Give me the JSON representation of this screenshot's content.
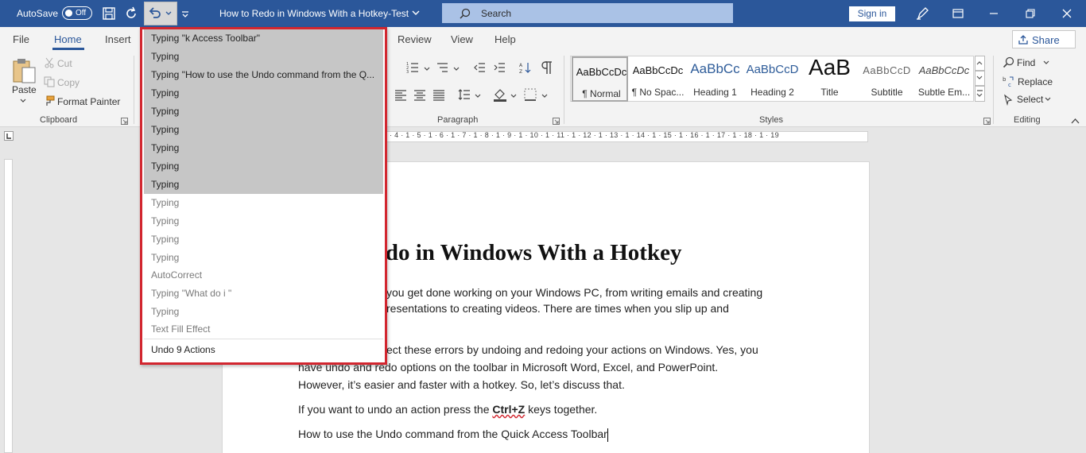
{
  "titlebar": {
    "autosave_label": "AutoSave",
    "autosave_state": "Off",
    "document_title": "How to Redo in Windows With a Hotkey-Test",
    "search_placeholder": "Search",
    "sign_in_label": "Sign in",
    "bar_color": "#2b579a"
  },
  "tabs": {
    "items": [
      "File",
      "Home",
      "Insert",
      "Review",
      "View",
      "Help"
    ],
    "active": "Home",
    "share_label": "Share"
  },
  "ribbon": {
    "clipboard": {
      "paste": "Paste",
      "cut": "Cut",
      "copy": "Copy",
      "format_painter": "Format Painter",
      "group_label": "Clipboard"
    },
    "paragraph": {
      "group_label": "Paragraph"
    },
    "styles": {
      "group_label": "Styles",
      "items": [
        {
          "preview": "AaBbCcDc",
          "name": "¶ Normal"
        },
        {
          "preview": "AaBbCcDc",
          "name": "¶ No Spac..."
        },
        {
          "preview": "AaBbCc",
          "name": "Heading 1"
        },
        {
          "preview": "AaBbCcD",
          "name": "Heading 2"
        },
        {
          "preview": "AaB",
          "name": "Title"
        },
        {
          "preview": "AaBbCcD",
          "name": "Subtitle"
        },
        {
          "preview": "AaBbCcDc",
          "name": "Subtle Em..."
        }
      ]
    },
    "editing": {
      "find": "Find",
      "replace": "Replace",
      "select": "Select",
      "group_label": "Editing"
    }
  },
  "ruler": {
    "numbers": "· 4 · 1 · 5 · 1 · 6 · 1 · 7 · 1 · 8 · 1 · 9 · 1 · 10 · 1 · 11 · 1 · 12 · 1 · 13 · 1 · 14 · 1 · 15 · 1 · 16 · 1 · 17 · 1 · 18 · 1 · 19"
  },
  "undo_dropdown": {
    "items": [
      {
        "label": "Typing \"k Access Toolbar\"",
        "selected": true
      },
      {
        "label": "Typing",
        "selected": true
      },
      {
        "label": "Typing \"How to use the Undo command from the Q...",
        "selected": true
      },
      {
        "label": "Typing",
        "selected": true
      },
      {
        "label": "Typing",
        "selected": true
      },
      {
        "label": "Typing",
        "selected": true
      },
      {
        "label": "Typing",
        "selected": true
      },
      {
        "label": "Typing",
        "selected": true
      },
      {
        "label": "Typing",
        "selected": true
      },
      {
        "label": "Typing",
        "selected": false
      },
      {
        "label": "Typing",
        "selected": false
      },
      {
        "label": "Typing",
        "selected": false
      },
      {
        "label": "Typing",
        "selected": false
      },
      {
        "label": "AutoCorrect",
        "selected": false
      },
      {
        "label": "Typing \"What do i \"",
        "selected": false
      },
      {
        "label": "Typing",
        "selected": false
      },
      {
        "label": "Text Fill Effect",
        "selected": false
      }
    ],
    "footer": "Undo 9 Actions",
    "highlight_color": "#d2262f"
  },
  "document": {
    "heading": "edo in Windows With a Hotkey",
    "para1_line1": "you get done working on your Windows PC, from writing emails and creating",
    "para1_line2": "resentations to creating videos.  There are times when you slip up and",
    "para2_line1": "ect these errors by undoing and redoing your actions on Windows. Yes, you",
    "para2_line2": "have undo and redo options on the toolbar in Microsoft Word, Excel, and PowerPoint.",
    "para2_line3": "However, it’s easier and faster with a hotkey. So, let’s discuss that.",
    "para3_before": "If you want to undo an action press the ",
    "para3_key": "Ctrl+Z",
    "para3_after": " keys together.",
    "para4": "How to use the Undo command from the Quick Access Toolbar"
  }
}
